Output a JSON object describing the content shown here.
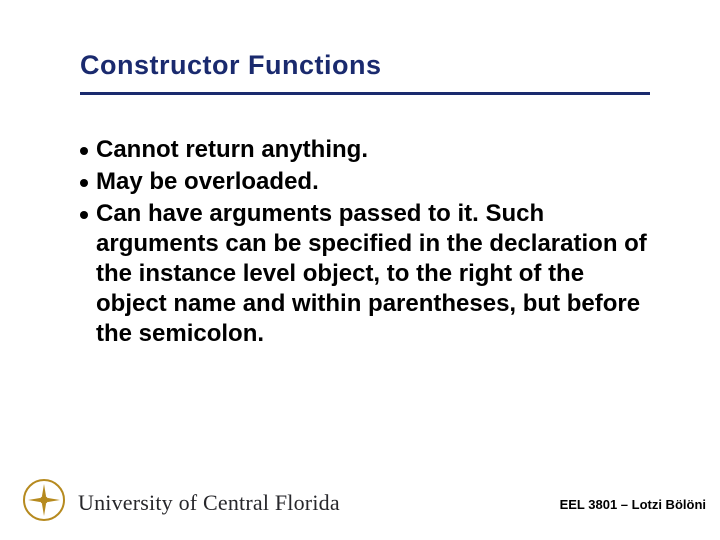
{
  "title": "Constructor Functions",
  "bullets": [
    "Cannot return anything.",
    "May be overloaded.",
    "Can have arguments passed to it.  Such arguments can be specified in the declaration of the instance level object, to the right of the object name and within parentheses, but before the semicolon."
  ],
  "footer": {
    "university": "University of Central Florida",
    "course": "EEL 3801 – Lotzi Bölöni"
  },
  "colors": {
    "accent": "#1a2a6e",
    "logo_gold": "#b68a1f"
  }
}
